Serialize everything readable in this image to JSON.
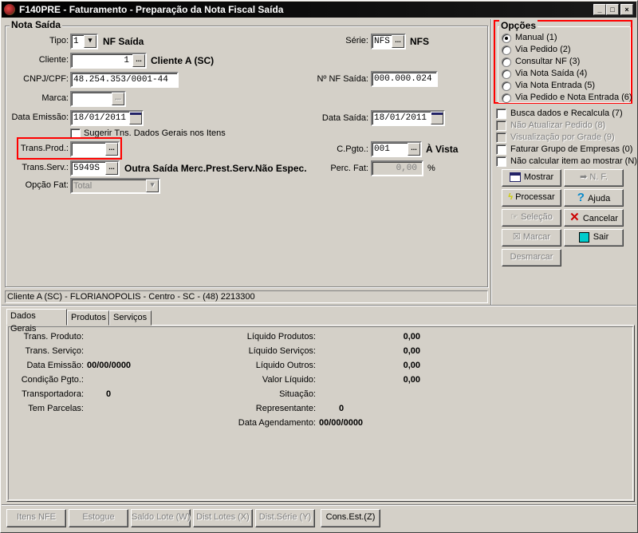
{
  "window": {
    "title": "F140PRE - Faturamento - Preparação da Nota Fiscal Saída",
    "controls": [
      "_",
      "□",
      "×"
    ]
  },
  "nota_saida": {
    "group_label": "Nota Saída",
    "tipo": {
      "label": "Tipo:",
      "value": "1",
      "desc": "NF Saída"
    },
    "cliente": {
      "label": "Cliente:",
      "value": "1",
      "desc": "Cliente A (SC)"
    },
    "cnpj": {
      "label": "CNPJ/CPF:",
      "value": "48.254.353/0001-44"
    },
    "marca": {
      "label": "Marca:",
      "value": ""
    },
    "data_emissao": {
      "label": "Data Emissão:",
      "value": "18/01/2011"
    },
    "sugerir": {
      "label": "Sugerir Tns. Dados Gerais nos Itens",
      "checked": false
    },
    "trans_prod": {
      "label": "Trans.Prod.:",
      "value": ""
    },
    "trans_serv": {
      "label": "Trans.Serv.:",
      "value": "5949S",
      "desc": "Outra Saída Merc.Prest.Serv.Não Espec."
    },
    "opcao_fat": {
      "label": "Opção Fat:",
      "value": "Total"
    },
    "serie": {
      "label": "Série:",
      "value": "NFS",
      "desc": "NFS"
    },
    "nf_saida": {
      "label": "Nº NF Saída:",
      "value": "000.000.024"
    },
    "data_saida": {
      "label": "Data Saída:",
      "value": "18/01/2011"
    },
    "cpgto": {
      "label": "C.Pgto.:",
      "value": "001",
      "desc": "À Vista"
    },
    "perc_fat": {
      "label": "Perc. Fat:",
      "value": "0,00",
      "unit": "%"
    },
    "ellipsis": "..."
  },
  "status_line": "Cliente A (SC) - FLORIANOPOLIS - Centro - SC - (48) 2213300",
  "opcoes": {
    "label": "Opções",
    "radios": [
      "Manual (1)",
      "Via Pedido (2)",
      "Consultar NF (3)",
      "Via Nota Saída (4)",
      "Via Nota Entrada (5)",
      "Via Pedido e Nota Entrada (6)"
    ],
    "selected": 0,
    "checks": [
      {
        "label": "Busca dados e Recalcula (7)",
        "enabled": true
      },
      {
        "label": "Não Atualizar Pedido (8)",
        "enabled": false
      },
      {
        "label": "Visualização por Grade (9)",
        "enabled": false
      },
      {
        "label": "Faturar Grupo de Empresas (0)",
        "enabled": true
      },
      {
        "label": "Não calcular item ao mostrar (N)",
        "enabled": true
      }
    ]
  },
  "buttons": {
    "mostrar": "Mostrar",
    "nf": "N. F.",
    "processar": "Processar",
    "ajuda": "Ajuda",
    "selecao": "Seleção",
    "cancelar": "Cancelar",
    "marcar": "Marcar",
    "sair": "Sair",
    "desmarcar": "Desmarcar"
  },
  "tabs": [
    "Dados Gerais",
    "Produtos",
    "Serviços"
  ],
  "dados_gerais": {
    "left": [
      {
        "label": "Trans. Produto:",
        "value": ""
      },
      {
        "label": "Trans. Serviço:",
        "value": ""
      },
      {
        "label": "Data Emissão:",
        "value": "00/00/0000"
      },
      {
        "label": "Condição Pgto.:",
        "value": ""
      },
      {
        "label": "Transportadora:",
        "value": "0"
      },
      {
        "label": "Tem Parcelas:",
        "value": ""
      }
    ],
    "right": [
      {
        "label": "Líquido Produtos:",
        "value": "0,00"
      },
      {
        "label": "Líquido Serviços:",
        "value": "0,00"
      },
      {
        "label": "Líquido Outros:",
        "value": "0,00"
      },
      {
        "label": "Valor Líquido:",
        "value": "0,00"
      },
      {
        "label": "Situação:",
        "value": ""
      },
      {
        "label": "Representante:",
        "value": "0"
      },
      {
        "label": "Data Agendamento:",
        "value": "00/00/0000"
      }
    ]
  },
  "bottom_buttons": [
    {
      "label": "Itens NFE",
      "enabled": false
    },
    {
      "label": "Estogue",
      "enabled": false
    },
    {
      "label": "Saldo Lote (W)",
      "enabled": false
    },
    {
      "label": "Dist Lotes (X)",
      "enabled": false
    },
    {
      "label": "Dist.Série (Y)",
      "enabled": false
    },
    {
      "label": "Cons.Est.(Z)",
      "enabled": true
    }
  ]
}
